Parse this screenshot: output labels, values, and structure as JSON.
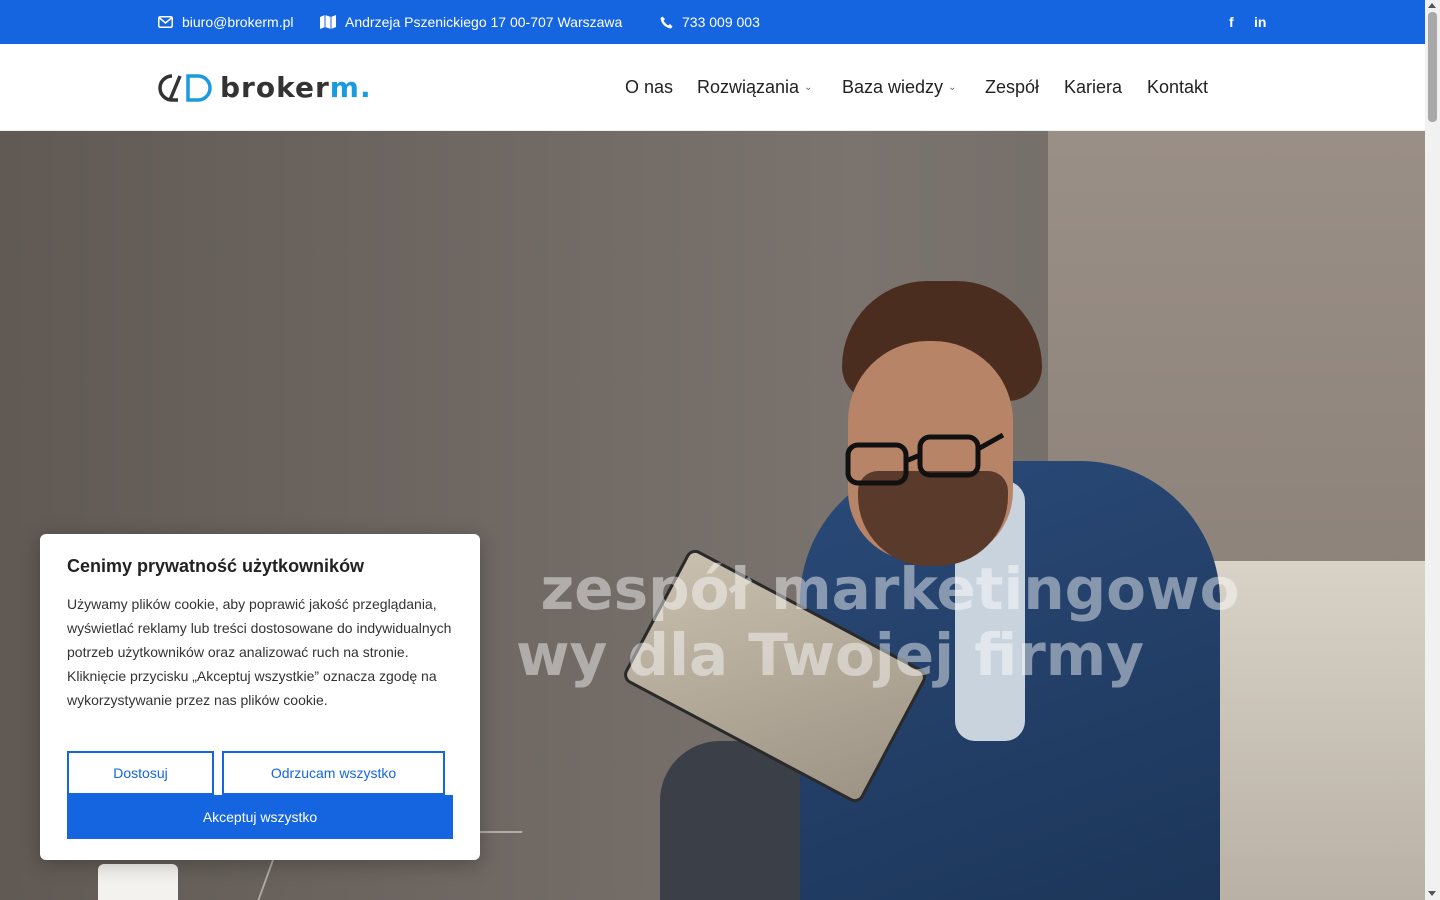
{
  "topbar": {
    "email": "biuro@brokerm.pl",
    "address": "Andrzeja Pszenickiego 17 00-707 Warszawa",
    "phone": "733 009 003",
    "social": {
      "facebook": "f",
      "linkedin": "in"
    },
    "icons": {
      "email": "envelope-icon",
      "address": "map-icon",
      "phone": "phone-icon"
    }
  },
  "logo": {
    "text_main": "broker",
    "text_accent": "m."
  },
  "nav": {
    "items": [
      {
        "label": "O nas"
      },
      {
        "label": "Rozwiązania"
      },
      {
        "label": "Baza wiedzy"
      },
      {
        "label": "Zespół"
      },
      {
        "label": "Kariera"
      },
      {
        "label": "Kontakt"
      }
    ]
  },
  "hero": {
    "title_line1": "zespół marketingowo",
    "title_line2": "wy dla Twojej firmy"
  },
  "cookie": {
    "title": "Cenimy prywatność użytkowników",
    "body": "Używamy plików cookie, aby poprawić jakość przeglądania, wyświetlać reklamy lub treści dostosowane do indywidualnych potrzeb użytkowników oraz analizować ruch na stronie. Kliknięcie przycisku „Akceptuj wszystkie” oznacza zgodę na wykorzystywanie przez nas plików cookie.",
    "customize_label": "Dostosuj",
    "reject_label": "Odrzucam wszystko",
    "accept_label": "Akceptuj wszystko"
  },
  "colors": {
    "brand_blue": "#1565e0",
    "logo_accent": "#1a9be0"
  }
}
